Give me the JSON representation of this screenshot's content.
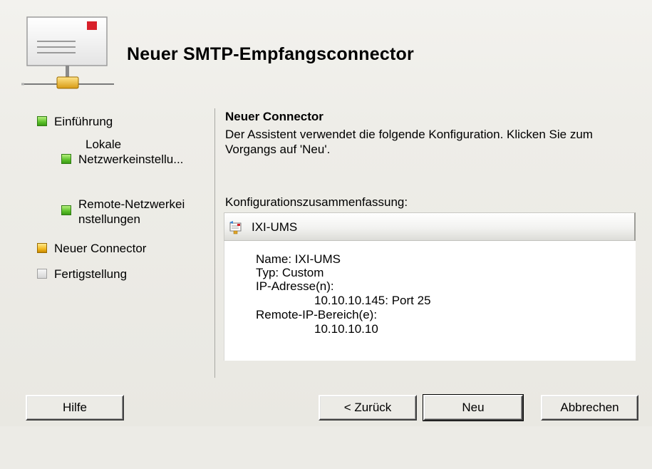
{
  "header": {
    "title": "Neuer SMTP-Empfangsconnector",
    "icon": "envelope-connector-icon"
  },
  "steps": [
    {
      "label_lines": [
        "Einführung"
      ],
      "state": "done"
    },
    {
      "label_lines": [
        "Lokale",
        "Netzwerkeinstellu..."
      ],
      "state": "done"
    },
    {
      "label_lines": [
        "Remote-Netzwerkei",
        "nstellungen"
      ],
      "state": "done"
    },
    {
      "label_lines": [
        "Neuer Connector"
      ],
      "state": "current"
    },
    {
      "label_lines": [
        "Fertigstellung"
      ],
      "state": "pending"
    }
  ],
  "content": {
    "section_title": "Neuer Connector",
    "description_line1": "Der Assistent verwendet die folgende Konfiguration. Klicken Sie zum",
    "description_line2": "Vorgangs auf 'Neu'.",
    "summary_label": "Konfigurationszusammenfassung:"
  },
  "summary": {
    "name": "IXI-UMS",
    "icon": "connector-item-icon",
    "details": {
      "name_line": "Name: IXI-UMS",
      "type_line": "Typ: Custom",
      "ip_label": "IP-Adresse(n):",
      "ip_value": "10.10.10.145: Port 25",
      "remote_label": "Remote-IP-Bereich(e):",
      "remote_value": "10.10.10.10"
    }
  },
  "buttons": {
    "help": "Hilfe",
    "back": "< Zurück",
    "new": "Neu",
    "cancel": "Abbrechen"
  },
  "colors": {
    "step_done": "#5cc12a",
    "step_current": "#f2b820",
    "step_pending": "#d6d6d6",
    "window_bg": "#ecebe6"
  }
}
